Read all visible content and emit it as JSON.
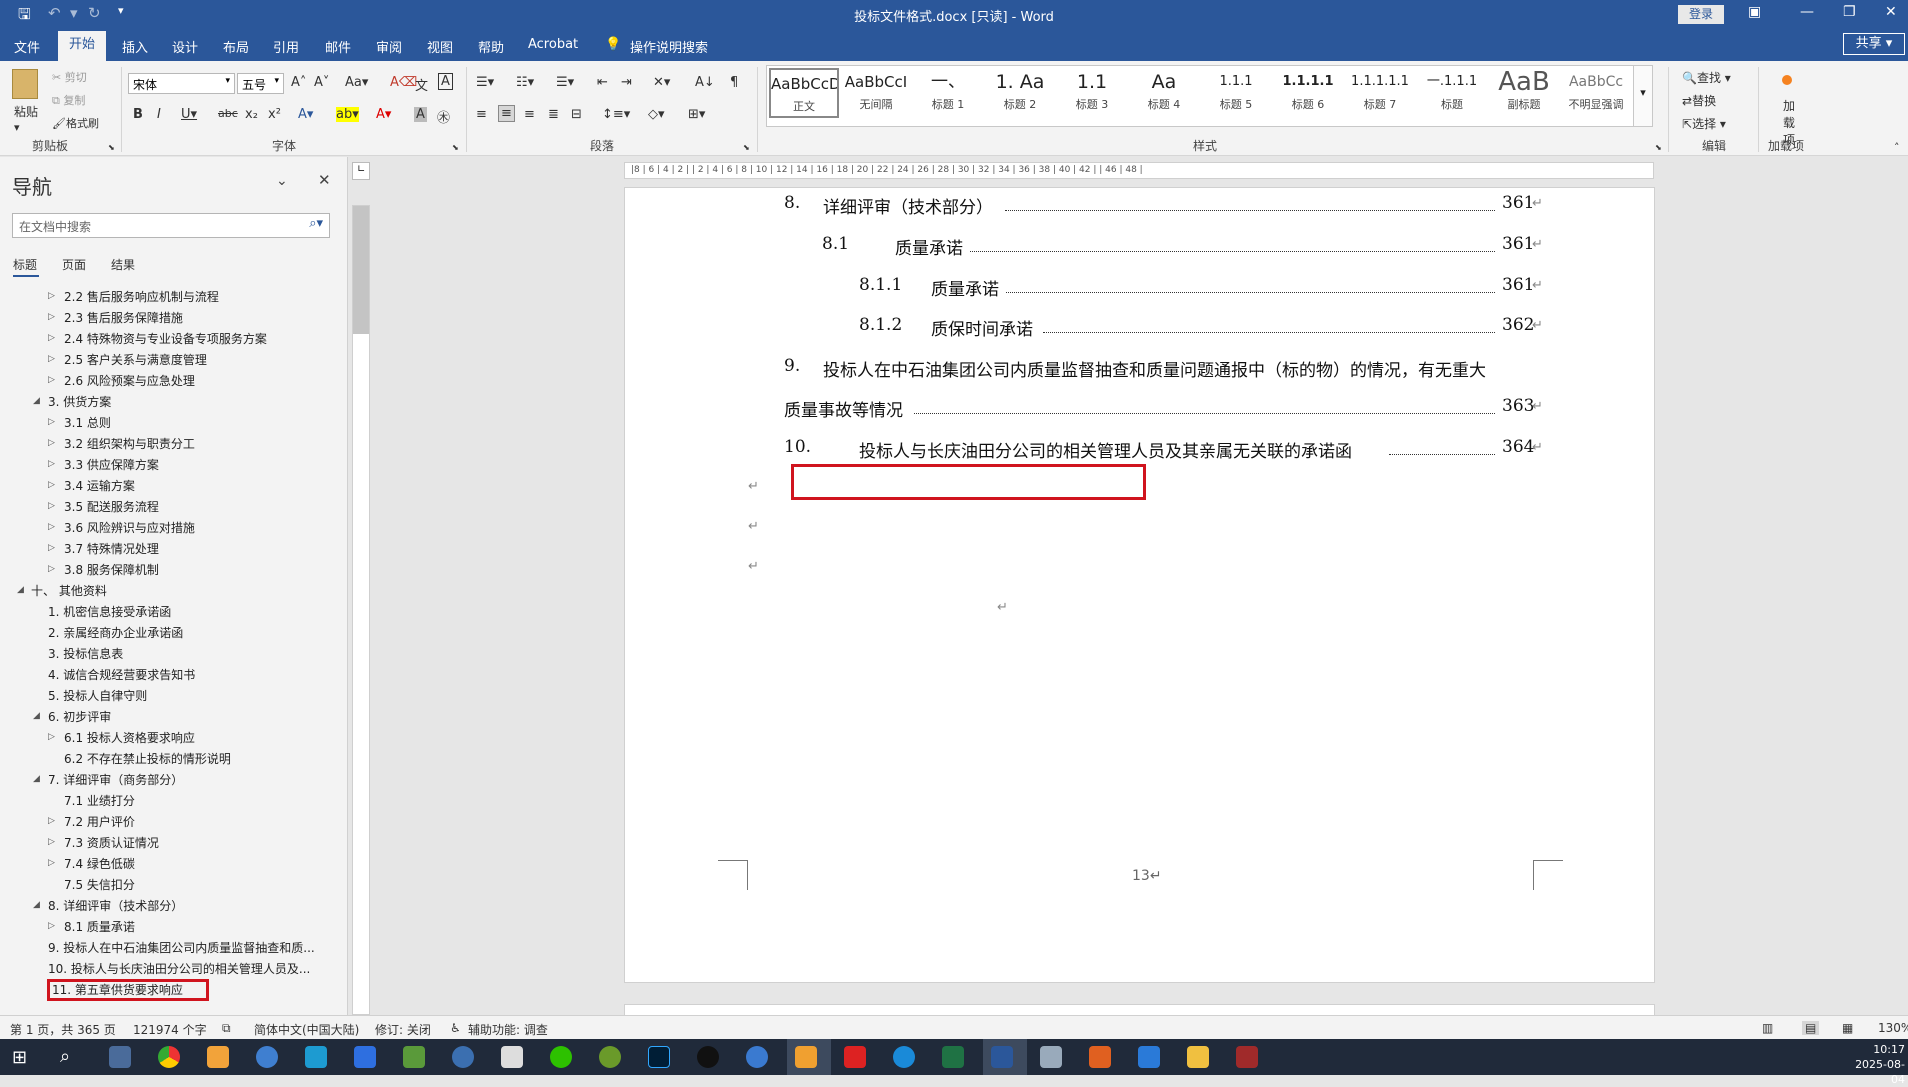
{
  "titlebar": {
    "title": "投标文件格式.docx [只读] - Word",
    "login": "登录"
  },
  "tabs": [
    "文件",
    "开始",
    "插入",
    "设计",
    "布局",
    "引用",
    "邮件",
    "审阅",
    "视图",
    "帮助",
    "Acrobat",
    "操作说明搜索"
  ],
  "share": "共享",
  "ribbon": {
    "clipboard": {
      "paste": "粘贴",
      "cut": "剪切",
      "copy": "复制",
      "format_painter": "格式刷",
      "label": "剪贴板"
    },
    "font": {
      "name": "宋体",
      "size": "五号",
      "label": "字体"
    },
    "paragraph": {
      "label": "段落"
    },
    "styles": {
      "label": "样式",
      "items": [
        {
          "preview": "AaBbCcDı",
          "name": "正文"
        },
        {
          "preview": "AaBbCcI",
          "name": "无间隔"
        },
        {
          "preview": "一、",
          "name": "标题 1"
        },
        {
          "preview": "1. Aa",
          "name": "标题 2"
        },
        {
          "preview": "1.1",
          "name": "标题 3"
        },
        {
          "preview": "Aa",
          "name": "标题 4"
        },
        {
          "preview": "1.1.1",
          "name": "标题 5"
        },
        {
          "preview": "1.1.1.1",
          "name": "标题 6"
        },
        {
          "preview": "1.1.1.1.1",
          "name": "标题 7"
        },
        {
          "preview": "一.1.1.1",
          "name": "标题"
        },
        {
          "preview": "AaB",
          "name": "副标题"
        },
        {
          "preview": "AaBbCc",
          "name": "不明显强调"
        }
      ]
    },
    "editing": {
      "find": "查找",
      "replace": "替换",
      "select": "选择",
      "label": "编辑"
    },
    "addins": {
      "button": "加载项",
      "label": "加载项"
    }
  },
  "nav": {
    "title": "导航",
    "search_placeholder": "在文档中搜索",
    "tabs": [
      "标题",
      "页面",
      "结果"
    ],
    "items": [
      "2.2 售后服务响应机制与流程",
      "2.3 售后服务保障措施",
      "2.4 特殊物资与专业设备专项服务方案",
      "2.5 客户关系与满意度管理",
      "2.6 风险预案与应急处理",
      "3. 供货方案",
      "3.1 总则",
      "3.2 组织架构与职责分工",
      "3.3 供应保障方案",
      "3.4 运输方案",
      "3.5 配送服务流程",
      "3.6 风险辨识与应对措施",
      "3.7 特殊情况处理",
      "3.8 服务保障机制",
      "十、 其他资料",
      "1. 机密信息接受承诺函",
      "2. 亲属经商办企业承诺函",
      "3. 投标信息表",
      "4. 诚信合规经营要求告知书",
      "5. 投标人自律守则",
      "6. 初步评审",
      "6.1 投标人资格要求响应",
      "6.2 不存在禁止投标的情形说明",
      "7. 详细评审（商务部分）",
      "7.1 业绩打分",
      "7.2 用户评价",
      "7.3 资质认证情况",
      "7.4 绿色低碳",
      "7.5 失信扣分",
      "8. 详细评审（技术部分）",
      "8.1 质量承诺",
      "9. 投标人在中石油集团公司内质量监督抽查和质...",
      "10. 投标人与长庆油田分公司的相关管理人员及...",
      "11. 第五章供货要求响应"
    ]
  },
  "ruler": "|8 | 6 | 4 | 2 |   | 2 | 4 | 6 | 8 | 10 | 12 | 14 | 16 | 18 | 20 | 22 | 24 | 26 | 28 | 30 | 32 | 34 | 36 | 38 | 40 | 42 |   | 46 | 48 |",
  "document": {
    "toc": [
      {
        "num": "8.",
        "text": "详细评审（技术部分）",
        "page": "361"
      },
      {
        "num": "8.1",
        "text": "质量承诺",
        "page": "361"
      },
      {
        "num": "8.1.1",
        "text": "质量承诺",
        "page": "361"
      },
      {
        "num": "8.1.2",
        "text": "质保时间承诺",
        "page": "362"
      },
      {
        "num": "9.",
        "text": "投标人在中石油集团公司内质量监督抽查和质量问题通报中（标的物）的情况，有无重大",
        "text2": "质量事故等情况",
        "page": "363"
      },
      {
        "num": "10.",
        "text": "投标人与长庆油田分公司的相关管理人员及其亲属无关联的承诺函",
        "page": "364"
      }
    ],
    "return_mark": "↵",
    "footer_page": "13↵"
  },
  "status": {
    "page": "第 1 页，共 365 页",
    "words": "121974 个字",
    "lang": "简体中文(中国大陆)",
    "track": "修订: 关闭",
    "access": "辅助功能: 调查",
    "zoom": "130%"
  },
  "clock": {
    "time": "10:17",
    "date": "2025-08-04"
  }
}
